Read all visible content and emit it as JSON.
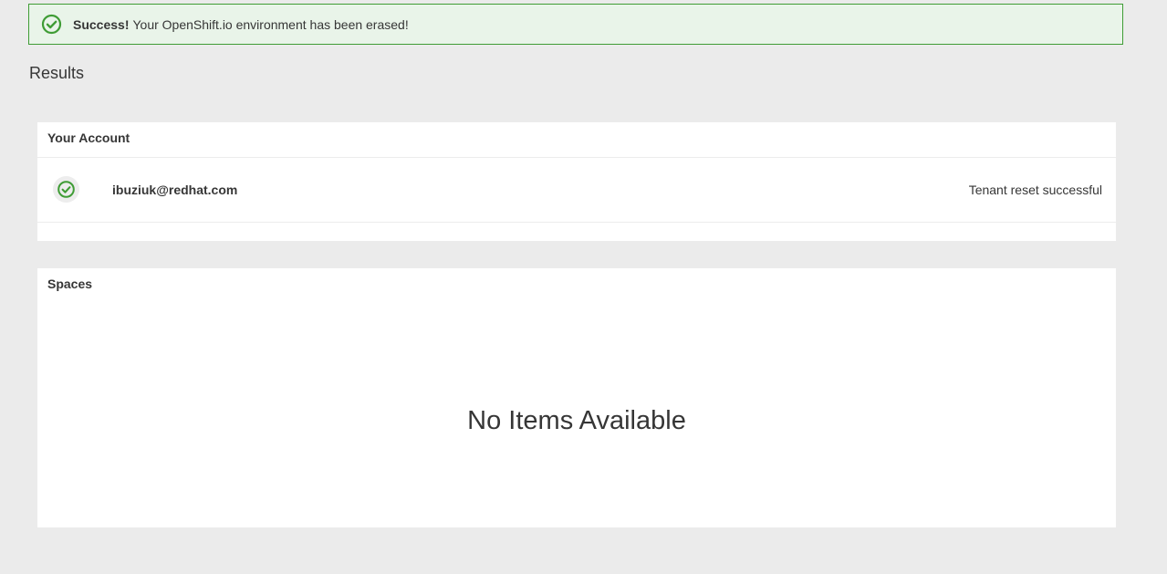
{
  "alert": {
    "icon": "check-circle-icon",
    "strong": "Success!",
    "message": "Your OpenShift.io environment has been erased!",
    "color": "#3f9c35"
  },
  "results": {
    "heading": "Results"
  },
  "account_card": {
    "title": "Your Account",
    "row": {
      "icon": "check-circle-icon",
      "email": "ibuziuk@redhat.com",
      "status": "Tenant reset successful"
    }
  },
  "spaces_card": {
    "title": "Spaces",
    "empty_text": "No Items Available"
  }
}
